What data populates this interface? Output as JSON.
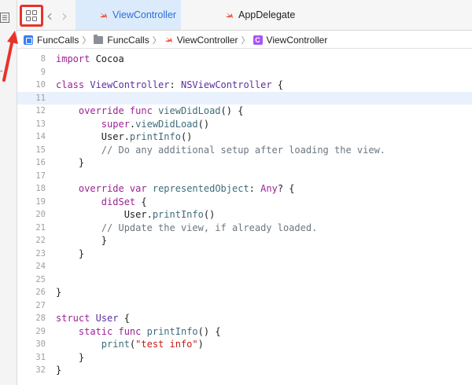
{
  "tabs": {
    "active_label": "ViewController",
    "inactive_label": "AppDelegate"
  },
  "breadcrumb": {
    "project": "FuncCalls",
    "folder": "FuncCalls",
    "file": "ViewController",
    "symbol": "ViewController"
  },
  "annotation_color": "#e8332a",
  "lines": [
    {
      "n": "8",
      "segs": [
        [
          "kw",
          "import"
        ],
        [
          "pl",
          " Cocoa"
        ]
      ]
    },
    {
      "n": "9",
      "segs": []
    },
    {
      "n": "10",
      "segs": [
        [
          "kw",
          "class"
        ],
        [
          "pl",
          " "
        ],
        [
          "ty",
          "ViewController"
        ],
        [
          "pl",
          ": "
        ],
        [
          "ty",
          "NSViewController"
        ],
        [
          "pl",
          " {"
        ]
      ]
    },
    {
      "n": "11",
      "segs": [],
      "current": true
    },
    {
      "n": "12",
      "segs": [
        [
          "pl",
          "    "
        ],
        [
          "kw",
          "override func"
        ],
        [
          "pl",
          " "
        ],
        [
          "fn",
          "viewDidLoad"
        ],
        [
          "pl",
          "() {"
        ]
      ]
    },
    {
      "n": "13",
      "segs": [
        [
          "pl",
          "        "
        ],
        [
          "kw",
          "super"
        ],
        [
          "pl",
          "."
        ],
        [
          "fn",
          "viewDidLoad"
        ],
        [
          "pl",
          "()"
        ]
      ]
    },
    {
      "n": "14",
      "segs": [
        [
          "pl",
          "        User."
        ],
        [
          "fn",
          "printInfo"
        ],
        [
          "pl",
          "()"
        ]
      ]
    },
    {
      "n": "15",
      "segs": [
        [
          "pl",
          "        "
        ],
        [
          "cm",
          "// Do any additional setup after loading the view."
        ]
      ]
    },
    {
      "n": "16",
      "segs": [
        [
          "pl",
          "    }"
        ]
      ]
    },
    {
      "n": "17",
      "segs": []
    },
    {
      "n": "18",
      "segs": [
        [
          "pl",
          "    "
        ],
        [
          "kw",
          "override var"
        ],
        [
          "pl",
          " "
        ],
        [
          "fn",
          "representedObject"
        ],
        [
          "pl",
          ": "
        ],
        [
          "kw",
          "Any"
        ],
        [
          "pl",
          "? {"
        ]
      ]
    },
    {
      "n": "19",
      "segs": [
        [
          "pl",
          "        "
        ],
        [
          "kw",
          "didSet"
        ],
        [
          "pl",
          " {"
        ]
      ]
    },
    {
      "n": "20",
      "segs": [
        [
          "pl",
          "            User."
        ],
        [
          "fn",
          "printInfo"
        ],
        [
          "pl",
          "()"
        ]
      ]
    },
    {
      "n": "21",
      "segs": [
        [
          "pl",
          "        "
        ],
        [
          "cm",
          "// Update the view, if already loaded."
        ]
      ]
    },
    {
      "n": "22",
      "segs": [
        [
          "pl",
          "        }"
        ]
      ]
    },
    {
      "n": "23",
      "segs": [
        [
          "pl",
          "    }"
        ]
      ]
    },
    {
      "n": "24",
      "segs": []
    },
    {
      "n": "25",
      "segs": []
    },
    {
      "n": "26",
      "segs": [
        [
          "pl",
          "}"
        ]
      ]
    },
    {
      "n": "27",
      "segs": []
    },
    {
      "n": "28",
      "segs": [
        [
          "kw",
          "struct"
        ],
        [
          "pl",
          " "
        ],
        [
          "ty",
          "User"
        ],
        [
          "pl",
          " {"
        ]
      ]
    },
    {
      "n": "29",
      "segs": [
        [
          "pl",
          "    "
        ],
        [
          "kw",
          "static func"
        ],
        [
          "pl",
          " "
        ],
        [
          "fn",
          "printInfo"
        ],
        [
          "pl",
          "() {"
        ]
      ]
    },
    {
      "n": "30",
      "segs": [
        [
          "pl",
          "        "
        ],
        [
          "fn",
          "print"
        ],
        [
          "pl",
          "("
        ],
        [
          "st",
          "\"test info\""
        ],
        [
          "pl",
          ")"
        ]
      ]
    },
    {
      "n": "31",
      "segs": [
        [
          "pl",
          "    }"
        ]
      ]
    },
    {
      "n": "32",
      "segs": [
        [
          "pl",
          "}"
        ]
      ]
    }
  ]
}
